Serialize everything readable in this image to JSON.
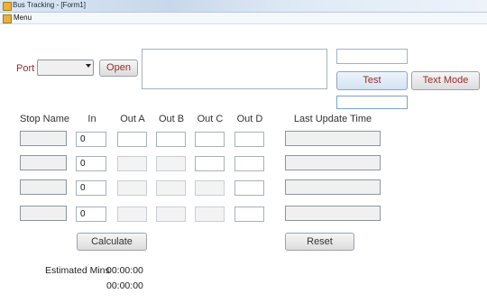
{
  "window": {
    "title": "Bus Tracking - [Form1]"
  },
  "menu": {
    "label": "Menu"
  },
  "port": {
    "label": "Port",
    "selected": "",
    "open_label": "Open"
  },
  "log_text": "",
  "top_right": {
    "field1": "",
    "field2": ""
  },
  "buttons": {
    "test": "Test",
    "text_mode": "Text Mode",
    "calculate": "Calculate",
    "reset": "Reset"
  },
  "headers": {
    "stop_name": "Stop Name",
    "in": "In",
    "out_a": "Out A",
    "out_b": "Out B",
    "out_c": "Out C",
    "out_d": "Out D",
    "last_update": "Last Update Time"
  },
  "rows": [
    {
      "stop_name": "",
      "in": "0",
      "out_a": "",
      "out_b": "",
      "out_c": "",
      "out_d": "",
      "last_update": ""
    },
    {
      "stop_name": "",
      "in": "0",
      "out_a": "",
      "out_b": "",
      "out_c": "",
      "out_d": "",
      "last_update": ""
    },
    {
      "stop_name": "",
      "in": "0",
      "out_a": "",
      "out_b": "",
      "out_c": "",
      "out_d": "",
      "last_update": ""
    },
    {
      "stop_name": "",
      "in": "0",
      "out_a": "",
      "out_b": "",
      "out_c": "",
      "out_d": "",
      "last_update": ""
    }
  ],
  "estimate": {
    "label": "Estimated Mins",
    "value1": "00:00:00",
    "value2": "00:00:00"
  }
}
